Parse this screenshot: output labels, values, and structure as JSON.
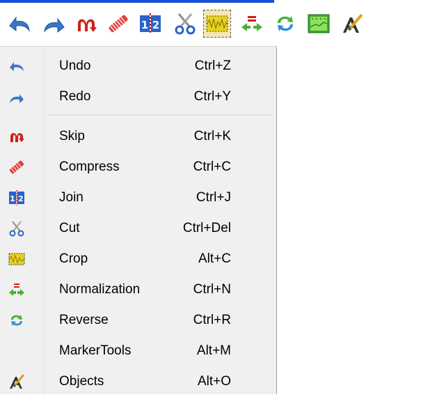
{
  "toolbar": {
    "buttons": [
      {
        "icon": "undo-icon"
      },
      {
        "icon": "redo-icon"
      },
      {
        "icon": "skip-icon"
      },
      {
        "icon": "compress-icon"
      },
      {
        "icon": "join-icon"
      },
      {
        "icon": "cut-icon"
      },
      {
        "icon": "crop-icon"
      },
      {
        "icon": "normalization-icon"
      },
      {
        "icon": "reverse-icon"
      },
      {
        "icon": "markertools-icon"
      },
      {
        "icon": "objects-icon"
      }
    ],
    "accent_color": "#1a4fd6"
  },
  "menu": {
    "items": [
      {
        "label": "Undo",
        "shortcut": "Ctrl+Z",
        "icon": "undo-icon"
      },
      {
        "label": "Redo",
        "shortcut": "Ctrl+Y",
        "icon": "redo-icon"
      },
      {
        "label": "Skip",
        "shortcut": "Ctrl+K",
        "icon": "skip-icon"
      },
      {
        "label": "Compress",
        "shortcut": "Ctrl+C",
        "icon": "compress-icon"
      },
      {
        "label": "Join",
        "shortcut": "Ctrl+J",
        "icon": "join-icon"
      },
      {
        "label": "Cut",
        "shortcut": "Ctrl+Del",
        "icon": "cut-icon"
      },
      {
        "label": "Crop",
        "shortcut": "Alt+C",
        "icon": "crop-icon"
      },
      {
        "label": "Normalization",
        "shortcut": "Ctrl+N",
        "icon": "normalization-icon"
      },
      {
        "label": "Reverse",
        "shortcut": "Ctrl+R",
        "icon": "reverse-icon"
      },
      {
        "label": "MarkerTools",
        "shortcut": "Alt+M",
        "icon": ""
      },
      {
        "label": "Objects",
        "shortcut": "Alt+O",
        "icon": "objects-icon"
      }
    ]
  }
}
